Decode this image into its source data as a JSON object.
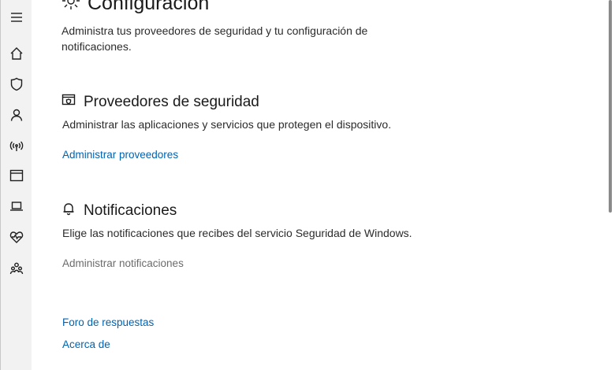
{
  "sidebar": {
    "items": [
      {
        "icon": "hamburger-menu-icon"
      },
      {
        "icon": "home-icon"
      },
      {
        "icon": "shield-icon"
      },
      {
        "icon": "person-icon"
      },
      {
        "icon": "wifi-antenna-icon"
      },
      {
        "icon": "app-browser-icon"
      },
      {
        "icon": "laptop-icon"
      },
      {
        "icon": "heart-pulse-icon"
      },
      {
        "icon": "family-icon"
      }
    ]
  },
  "main": {
    "title": "Configuración",
    "title_icon": "gear-icon",
    "description": "Administra tus proveedores de seguridad y tu configuración de notificaciones.",
    "sections": [
      {
        "icon": "security-providers-icon",
        "title": "Proveedores de seguridad",
        "description": "Administrar las aplicaciones y servicios que protegen el dispositivo.",
        "link": "Administrar proveedores"
      },
      {
        "icon": "bell-icon",
        "title": "Notificaciones",
        "description": "Elige las notificaciones que recibes del servicio Seguridad de Windows.",
        "link": "Administrar notificaciones"
      }
    ],
    "footer_links": [
      "Foro de respuestas",
      "Acerca de"
    ]
  },
  "colors": {
    "link": "#0063b1",
    "sidebar_bg": "#f2f2f2",
    "disabled_text": "#6b6b6b"
  }
}
